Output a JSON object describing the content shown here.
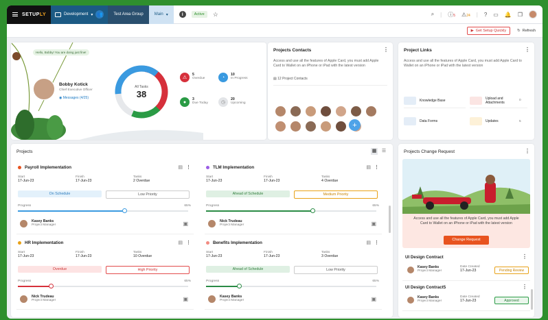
{
  "topbar": {
    "logo_a": "SETUP",
    "logo_b": "LY",
    "env": "Development",
    "test_group": "Test Area Group",
    "main": "Main",
    "active": "Active",
    "alert_count": "5",
    "warn_count": "24"
  },
  "subbar": {
    "setup": "Get Setup Quickly",
    "refresh": "Refresh"
  },
  "profile": {
    "greeting": "Hello, Bobby! You are doing just fine!",
    "name": "Bobby Kotick",
    "role": "Chief Executive Officer",
    "messages": "Messages (4/25)"
  },
  "tasks": {
    "label": "All Tasks",
    "total": "38",
    "stats": [
      {
        "num": "5",
        "label": "Overdue"
      },
      {
        "num": "10",
        "label": "In Progress"
      },
      {
        "num": "3",
        "label": "Due Today"
      },
      {
        "num": "20",
        "label": "Upcoming"
      }
    ]
  },
  "contacts": {
    "title": "Projects Contacts",
    "desc": "Access and use all the features of Apple Card, you must add Apple Card to Wallet on an iPhone or iPad with the latest version",
    "count": "12 Project Contacts",
    "add": "+"
  },
  "links": {
    "title": "Project Links",
    "desc": "Access and use all the features of Apple Card, you must add Apple Card to Wallet on an iPhone or iPad with the latest version",
    "items": [
      {
        "label": "Knowledge Base",
        "count": "5"
      },
      {
        "label": "Upload and Attachments",
        "count": "0"
      },
      {
        "label": "Data Forms",
        "count": "5"
      },
      {
        "label": "Updates",
        "count": "5"
      }
    ]
  },
  "projects": {
    "title": "Projects",
    "items": [
      {
        "title": "Payroll Implementation",
        "start_l": "Start",
        "start": "17-Jun-23",
        "finish_l": "Finish",
        "finish": "17-Jun-23",
        "tasks_l": "Tasks",
        "tasks": "2 Overdue",
        "status": "On Schedule",
        "priority": "Low Priority",
        "progress_l": "Progress",
        "progress_v": "65%",
        "progress": 0.65,
        "person": "Kasey Banks",
        "person_role": "Project Manager"
      },
      {
        "title": "TLM Implementation",
        "start_l": "Start",
        "start": "17-Jun-23",
        "finish_l": "Finish",
        "finish": "17-Jun-23",
        "tasks_l": "Tasks",
        "tasks": "4 Overdue",
        "status": "Ahead of Schedule",
        "priority": "Medium Priority",
        "progress_l": "Progress",
        "progress_v": "65%",
        "progress": 0.65,
        "person": "Nick Trudeau",
        "person_role": "Project Manager"
      },
      {
        "title": "HR Implementation",
        "start_l": "Start",
        "start": "17-Jun-23",
        "finish_l": "Finish",
        "finish": "17-Jun-23",
        "tasks_l": "Tasks",
        "tasks": "10 Overdue",
        "status": "Overdue",
        "priority": "High Priority",
        "progress_l": "Progress",
        "progress_v": "65%",
        "progress": 0.2,
        "person": "Nick Trudeau",
        "person_role": "Project Manager"
      },
      {
        "title": "Benefits Implementation",
        "start_l": "Start",
        "start": "17-Jun-23",
        "finish_l": "Finish",
        "finish": "17-Jun-23",
        "tasks_l": "Tasks",
        "tasks": "3 Overdue",
        "status": "Ahead of Schedule",
        "priority": "Low Priority",
        "progress_l": "Progress",
        "progress_v": "65%",
        "progress": 0.2,
        "person": "Kasey Banks",
        "person_role": "Project Manager"
      }
    ]
  },
  "change": {
    "title": "Projects Change Request",
    "desc": "Access and use all the features of Apple Card, you must add Apple Card to Wallet on an iPhone or iPad with the latest version",
    "button": "Change Request",
    "items": [
      {
        "title": "UI Design Contract",
        "person": "Kasey Banks",
        "person_role": "Project Manager",
        "date_l": "Date Created",
        "date": "17-Jun-23",
        "status": "Pending Review"
      },
      {
        "title": "UI Design Contract5",
        "person": "Kasey Banks",
        "person_role": "Project Manager",
        "date_l": "Date Created",
        "date": "17-Jun-23",
        "status": "Approved"
      }
    ]
  },
  "colors": {
    "blue": "#1c5a84",
    "accent": "#e24b4b",
    "green": "#2f8f2e"
  }
}
